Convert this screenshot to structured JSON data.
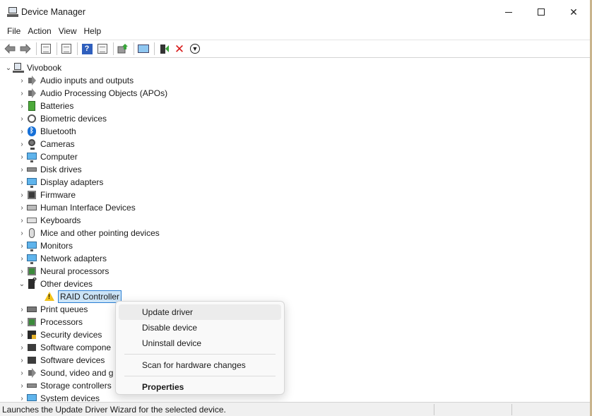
{
  "window": {
    "title": "Device Manager"
  },
  "menu": [
    "File",
    "Action",
    "View",
    "Help"
  ],
  "toolbar": [
    "back-arrow-icon",
    "forward-arrow-icon",
    "show-hide-console-tree-icon",
    "properties-sheet-icon",
    "help-icon",
    "action-pane-icon",
    "update-driver-icon",
    "scan-hardware-icon",
    "enable-device-icon",
    "uninstall-device-icon",
    "disable-device-icon"
  ],
  "tree": {
    "root": "Vivobook",
    "categories": [
      {
        "label": "Audio inputs and outputs",
        "icon": "speaker"
      },
      {
        "label": "Audio Processing Objects (APOs)",
        "icon": "speaker"
      },
      {
        "label": "Batteries",
        "icon": "battery"
      },
      {
        "label": "Biometric devices",
        "icon": "fingerprint"
      },
      {
        "label": "Bluetooth",
        "icon": "bluetooth"
      },
      {
        "label": "Cameras",
        "icon": "camera"
      },
      {
        "label": "Computer",
        "icon": "monitor"
      },
      {
        "label": "Disk drives",
        "icon": "disk"
      },
      {
        "label": "Display adapters",
        "icon": "monitor"
      },
      {
        "label": "Firmware",
        "icon": "chip"
      },
      {
        "label": "Human Interface Devices",
        "icon": "hid"
      },
      {
        "label": "Keyboards",
        "icon": "keyboard"
      },
      {
        "label": "Mice and other pointing devices",
        "icon": "mouse"
      },
      {
        "label": "Monitors",
        "icon": "monitor"
      },
      {
        "label": "Network adapters",
        "icon": "monitor"
      },
      {
        "label": "Neural processors",
        "icon": "chip-green"
      },
      {
        "label": "Other devices",
        "icon": "other"
      }
    ],
    "selected_child": "RAID Controller",
    "after": [
      {
        "label": "Print queues",
        "icon": "printer"
      },
      {
        "label": "Processors",
        "icon": "chip-green"
      },
      {
        "label": "Security devices",
        "icon": "security"
      },
      {
        "label": "Software compone",
        "icon": "generic"
      },
      {
        "label": "Software devices",
        "icon": "generic"
      },
      {
        "label": "Sound, video and g",
        "icon": "speaker"
      },
      {
        "label": "Storage controllers",
        "icon": "disk"
      },
      {
        "label": "System devices",
        "icon": "monitor"
      }
    ]
  },
  "context_menu": {
    "update": "Update driver",
    "disable": "Disable device",
    "uninstall": "Uninstall device",
    "scan": "Scan for hardware changes",
    "properties": "Properties"
  },
  "status": {
    "text": "Launches the Update Driver Wizard for the selected device."
  },
  "colors": {
    "selection_bg": "#cce4f7",
    "selection_border": "#2a7fd4",
    "menu_bg": "#f9f9f9"
  }
}
